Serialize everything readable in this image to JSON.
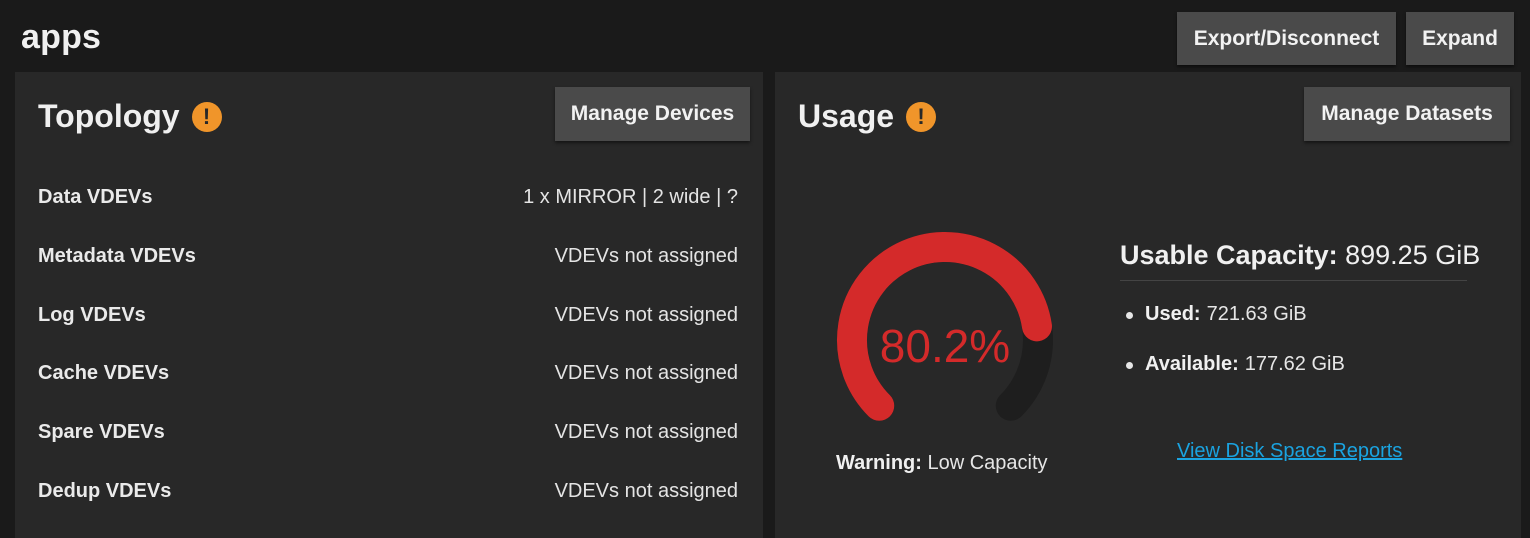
{
  "pool": {
    "name": "apps",
    "export_label": "Export/Disconnect",
    "expand_label": "Expand"
  },
  "topology": {
    "title": "Topology",
    "manage_label": "Manage Devices",
    "warning_icon": "exclamation-circle",
    "rows": [
      {
        "label": "Data VDEVs",
        "value": "1 x MIRROR | 2 wide | ?"
      },
      {
        "label": "Metadata VDEVs",
        "value": "VDEVs not assigned"
      },
      {
        "label": "Log VDEVs",
        "value": "VDEVs not assigned"
      },
      {
        "label": "Cache VDEVs",
        "value": "VDEVs not assigned"
      },
      {
        "label": "Spare VDEVs",
        "value": "VDEVs not assigned"
      },
      {
        "label": "Dedup VDEVs",
        "value": "VDEVs not assigned"
      }
    ]
  },
  "usage": {
    "title": "Usage",
    "manage_label": "Manage Datasets",
    "warning_icon": "exclamation-circle",
    "gauge": {
      "percent_text": "80.2%",
      "fraction": 0.802,
      "color": "#d42a2a",
      "track_color": "#1e1e1e"
    },
    "warning_label": "Warning:",
    "warning_text": "Low Capacity",
    "capacity_label": "Usable Capacity:",
    "capacity_value": "899.25 GiB",
    "used_label": "Used:",
    "used_value": "721.63 GiB",
    "available_label": "Available:",
    "available_value": "177.62 GiB",
    "reports_link": "View Disk Space Reports"
  },
  "colors": {
    "background": "#1a1a1a",
    "card": "#282828",
    "button": "#4a4a4a",
    "warning": "#f0952a",
    "link": "#1aa3e0"
  }
}
